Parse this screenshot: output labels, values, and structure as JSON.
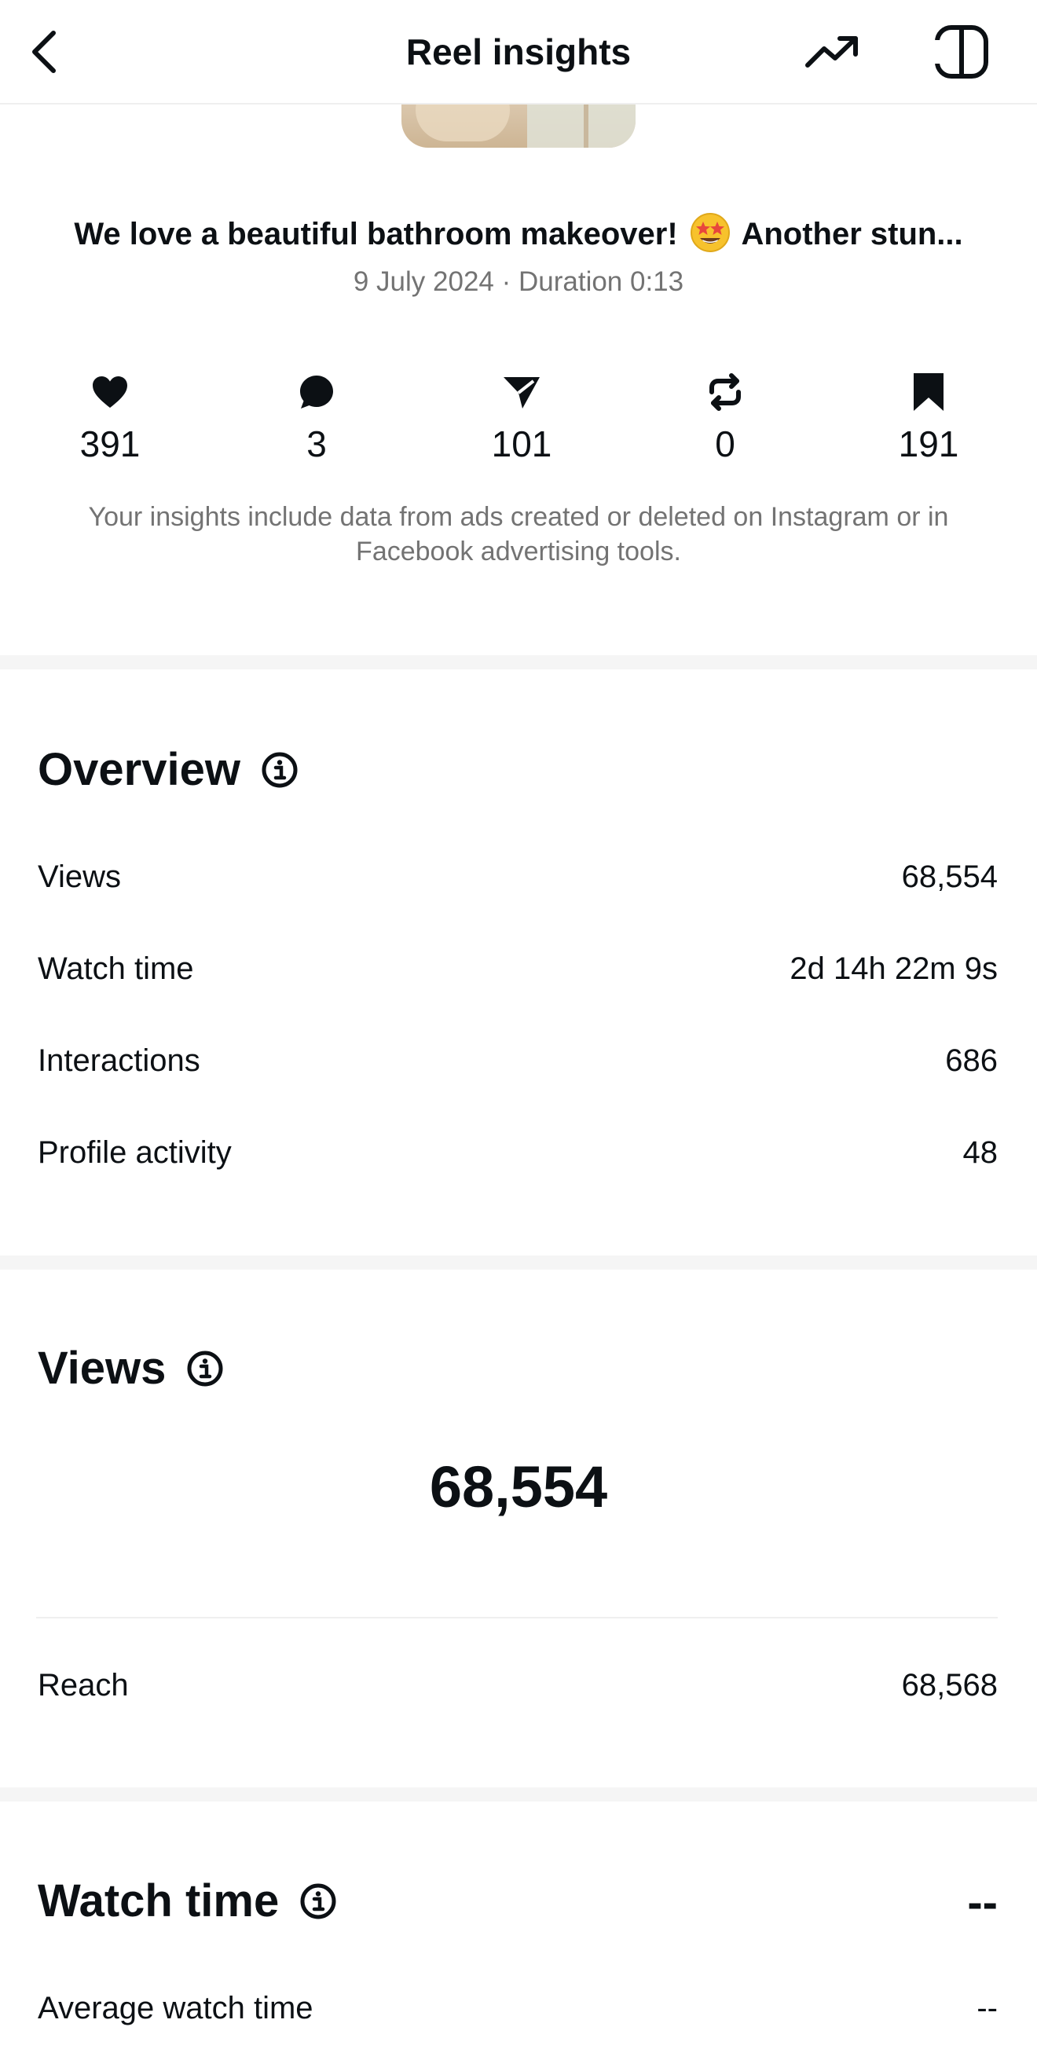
{
  "header": {
    "title": "Reel insights"
  },
  "reel": {
    "caption_start": "We love a beautiful bathroom makeover!",
    "caption_end": "Another stun...",
    "date_duration": "9 July 2024 · Duration 0:13"
  },
  "stats": [
    {
      "icon": "heart-icon",
      "value": "391"
    },
    {
      "icon": "comment-icon",
      "value": "3"
    },
    {
      "icon": "share-icon",
      "value": "101"
    },
    {
      "icon": "repost-icon",
      "value": "0"
    },
    {
      "icon": "save-icon",
      "value": "191"
    }
  ],
  "note": "Your insights include data from ads created or deleted on Instagram or in Facebook advertising tools.",
  "overview": {
    "title": "Overview",
    "rows": [
      {
        "label": "Views",
        "value": "68,554"
      },
      {
        "label": "Watch time",
        "value": "2d 14h 22m 9s"
      },
      {
        "label": "Interactions",
        "value": "686"
      },
      {
        "label": "Profile activity",
        "value": "48"
      }
    ]
  },
  "views": {
    "title": "Views",
    "total": "68,554",
    "reach_label": "Reach",
    "reach_value": "68,568"
  },
  "watch_time": {
    "title": "Watch time",
    "value": "--",
    "avg_label": "Average watch time",
    "avg_value": "--"
  }
}
